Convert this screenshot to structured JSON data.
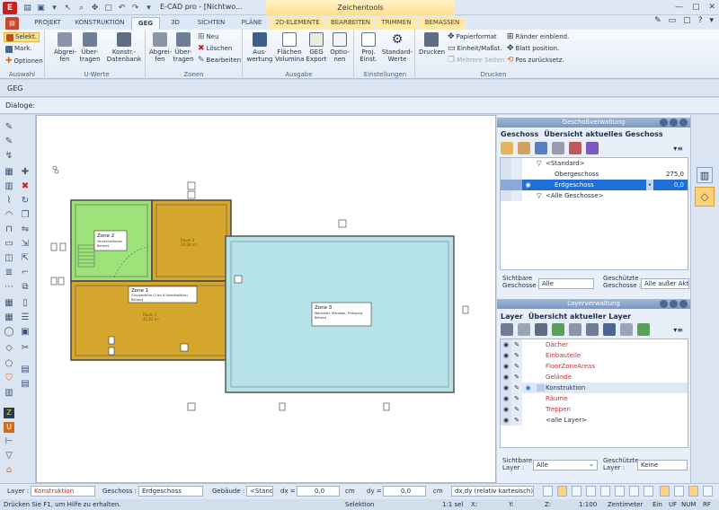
{
  "app": {
    "title": "E-CAD pro - [Nichtwo...",
    "context_tab_title": "Zeichentools",
    "logo": "E"
  },
  "tabs": [
    "PROJEKT",
    "KONSTRUKTION",
    "GEG",
    "3D",
    "SICHTEN",
    "PLÄNE",
    "2D-ELEMENTE",
    "BEARBEITEN",
    "TRIMMEN",
    "BEMASSEN"
  ],
  "ribbon": {
    "auswahl": {
      "label": "Auswahl",
      "selekt": "Selekt.",
      "mark": "Mark.",
      "optionen": "Optionen"
    },
    "uwerte": {
      "label": "U-Werte",
      "abgreifen": "Abgrei-\nfen",
      "uebertragen": "Über-\ntragen",
      "konstr": "Konstr.-\nDatenbank"
    },
    "zonen": {
      "label": "Zonen",
      "abgreifen": "Abgrei-\nfen",
      "uebertragen": "Über-\ntragen",
      "neu": "Neu",
      "loeschen": "Löschen",
      "bearbeiten": "Bearbeiten"
    },
    "ausgabe": {
      "label": "Ausgabe",
      "auswertung": "Aus-\nwertung",
      "flaechen": "Flächen\nVolumina",
      "geg_export": "GEG\nExport",
      "optionen": "Optio-\nnen"
    },
    "einstellungen": {
      "label": "Einstellungen",
      "proj": "Proj.\nEinst.",
      "standard": "Standard-\nWerte"
    },
    "drucken": {
      "label": "Drucken",
      "drucken": "Drucken",
      "papierformat": "Papierformat",
      "einheit": "Einheit/Maßst.",
      "mehrere": "Mehrere Seiten",
      "raender": "Ränder einblend.",
      "blatt": "Blatt position.",
      "pos": "Pos zurücksetz."
    }
  },
  "geg_label": "GEG",
  "dialoge_label": "Dialoge:",
  "plan": {
    "zone2_title": "Zone 2",
    "zone2_desc": "Verkehrsflächen\nBeheizt",
    "zone1_title": "Zone 1",
    "zone1_desc": "Gruppenbüro (2 bis 6 Arbeitsplätze)\nBeheizt",
    "zone3_title": "Zone 3",
    "zone3_desc": "Werkstatt, Montage, Fertigung\nBeheizt",
    "raum1": "Raum 1\n42,02 m²",
    "raum3": "Raum 3\n20,66 m²"
  },
  "geschoss_panel": {
    "title": "Geschoßverwaltung",
    "tab1": "Geschoss",
    "tab2": "Übersicht aktuelles Geschoss",
    "rows": [
      {
        "name": "<Standard>",
        "value": "",
        "indent": 0
      },
      {
        "name": "Obergeschoss",
        "value": "275,0",
        "indent": 1
      },
      {
        "name": "Erdgeschoss",
        "value": "0,0",
        "indent": 1,
        "selected": true
      },
      {
        "name": "<Alle Geschosse>",
        "value": "",
        "indent": 0
      }
    ],
    "sichtbar_label": "Sichtbare\nGeschosse :",
    "sichtbar_value": "Alle",
    "geschuetzt_label": "Geschützte\nGeschosse :",
    "geschuetzt_value": "Alle außer Aktive"
  },
  "layer_panel": {
    "title": "Layerverwaltung",
    "tab1": "Layer",
    "tab2": "Übersicht aktueller Layer",
    "rows": [
      {
        "name": "Dächer",
        "color": "#d42a2a"
      },
      {
        "name": "Einbauteile",
        "color": "#d42a2a"
      },
      {
        "name": "FloorZoneAreas",
        "color": "#d42a2a"
      },
      {
        "name": "Gelände",
        "color": "#d42a2a"
      },
      {
        "name": "Konstruktion",
        "color": "#1b2e4d",
        "active": true
      },
      {
        "name": "Räume",
        "color": "#d42a2a"
      },
      {
        "name": "Treppen",
        "color": "#d42a2a"
      },
      {
        "name": "<alle Layer>",
        "color": "#1b2e4d"
      }
    ],
    "sichtbar_label": "Sichtbare\nLayer :",
    "sichtbar_value": "Alle",
    "geschuetzt_label": "Geschützte\nLayer :",
    "geschuetzt_value": "Keine"
  },
  "bottombar": {
    "layer_label": "Layer :",
    "layer_value": "Konstruktion",
    "geschoss_label": "Geschoss :",
    "geschoss_value": "Erdgeschoss",
    "gebaeude_label": "Gebäude :",
    "gebaeude_value": "<Standa",
    "dx_label": "dx =",
    "dx_value": "0,0",
    "dy_label": "dy =",
    "dy_value": "0,0",
    "unit1": "cm",
    "unit2": "cm",
    "mode_value": "dx,dy (relativ kartesisch)"
  },
  "statusbar": {
    "help": "Drücken Sie F1, um Hilfe zu erhalten.",
    "mode": "Selektion",
    "sel": "1:1 sel",
    "x": "X:",
    "y": "Y:",
    "z": "Z:",
    "scale": "1:100",
    "unit": "Zentimeter",
    "ein": "Ein",
    "uf": "UF",
    "num": "NUM",
    "rf": "RF"
  },
  "colors": {
    "zone_green": "#9ee37a",
    "zone_brown": "#d4a72c",
    "zone_cyan": "#b6e3e8",
    "selection_blue": "#1f6fd6",
    "layer_red": "#d42a2a"
  }
}
